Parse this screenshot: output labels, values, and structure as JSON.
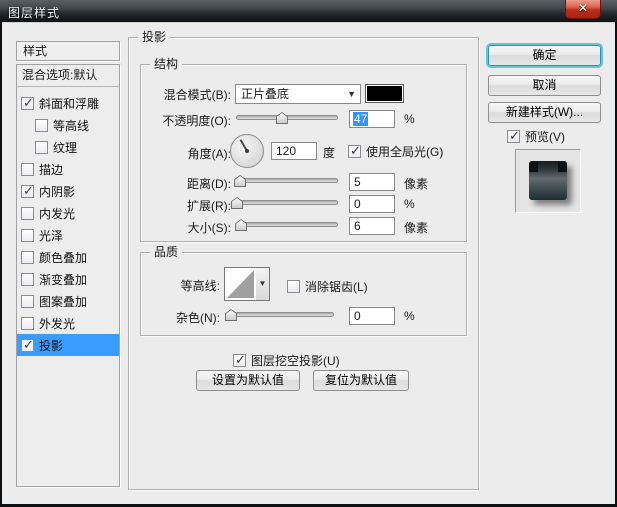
{
  "window": {
    "title": "图层样式",
    "close_glyph": "✕"
  },
  "colors": {
    "selection_blue": "#3b9cff",
    "swatch_black": "#000000",
    "ok_ring_teal": "#5fc8da",
    "close_button_red": "#b92e1d",
    "dialog_bg": "#ececec"
  },
  "sidebar": {
    "header": "样式",
    "blending_options": "混合选项:默认",
    "items": [
      {
        "label": "斜面和浮雕",
        "checked": true,
        "indent": false,
        "selected": false
      },
      {
        "label": "等高线",
        "checked": false,
        "indent": true,
        "selected": false
      },
      {
        "label": "纹理",
        "checked": false,
        "indent": true,
        "selected": false
      },
      {
        "label": "描边",
        "checked": false,
        "indent": false,
        "selected": false
      },
      {
        "label": "内阴影",
        "checked": true,
        "indent": false,
        "selected": false
      },
      {
        "label": "内发光",
        "checked": false,
        "indent": false,
        "selected": false
      },
      {
        "label": "光泽",
        "checked": false,
        "indent": false,
        "selected": false
      },
      {
        "label": "颜色叠加",
        "checked": false,
        "indent": false,
        "selected": false
      },
      {
        "label": "渐变叠加",
        "checked": false,
        "indent": false,
        "selected": false
      },
      {
        "label": "图案叠加",
        "checked": false,
        "indent": false,
        "selected": false
      },
      {
        "label": "外发光",
        "checked": false,
        "indent": false,
        "selected": false
      },
      {
        "label": "投影",
        "checked": true,
        "indent": false,
        "selected": true
      }
    ]
  },
  "panel": {
    "title": "投影",
    "structure": {
      "title": "结构",
      "blend_mode": {
        "label": "混合模式(B):",
        "value": "正片叠底",
        "swatch_color": "#000000"
      },
      "opacity": {
        "label": "不透明度(O):",
        "value": "47",
        "unit": "%",
        "percent": 45,
        "value_selected": true
      },
      "angle": {
        "label": "角度(A):",
        "value": "120",
        "unit": "度",
        "degrees": 120,
        "global_light_label": "使用全局光(G)",
        "global_light_checked": true
      },
      "distance": {
        "label": "距离(D):",
        "value": "5",
        "unit": "像素",
        "percent": 4
      },
      "spread": {
        "label": "扩展(R):",
        "value": "0",
        "unit": "%",
        "percent": 1
      },
      "size": {
        "label": "大小(S):",
        "value": "6",
        "unit": "像素",
        "percent": 5
      }
    },
    "quality": {
      "title": "品质",
      "contour": {
        "label": "等高线:",
        "antialias_label": "消除锯齿(L)",
        "antialias_checked": false
      },
      "noise": {
        "label": "杂色(N):",
        "value": "0",
        "unit": "%",
        "percent": 1
      }
    },
    "knockout": {
      "label": "图层挖空投影(U)",
      "checked": true
    },
    "buttons": {
      "make_default": "设置为默认值",
      "reset_default": "复位为默认值"
    }
  },
  "actions": {
    "ok": "确定",
    "cancel": "取消",
    "new_style": "新建样式(W)...",
    "preview_label": "预览(V)",
    "preview_checked": true
  }
}
